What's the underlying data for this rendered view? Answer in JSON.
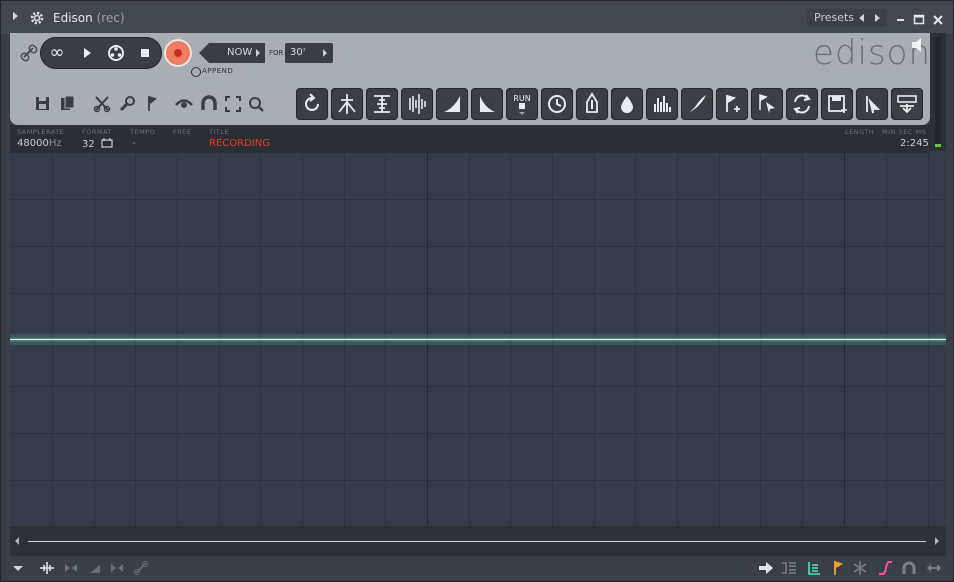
{
  "window": {
    "title": "Edison",
    "subtitle": "(rec)",
    "presets_label": "Presets"
  },
  "transport": {
    "now_label": "NOW",
    "for_label": "FOR",
    "duration": "30'",
    "append_label": "APPEND",
    "record_color": "#f07d63"
  },
  "logo": {
    "text": "edison"
  },
  "toolbar": {
    "left_icons": [
      "save-icon",
      "copy-icon",
      "cut-icon",
      "wrench-icon",
      "marker-icon",
      "view-icon",
      "snap-magnet-icon",
      "select-all-icon",
      "zoom-icon"
    ],
    "tools": [
      "reverse-icon",
      "normalize-icon",
      "trim-icon",
      "declick-icon",
      "fade-in-icon",
      "fade-out-icon",
      "run-script-icon",
      "time-stretch-icon",
      "noise-gate-icon",
      "denoise-icon",
      "spectrum-icon",
      "eq-icon",
      "add-marker-icon",
      "region-icon",
      "loop-icon",
      "save-region-icon",
      "send-to-playlist-icon",
      "send-to-channel-icon"
    ],
    "run_label": "RUN"
  },
  "info": {
    "samplerate_label": "SAMPLERATE",
    "samplerate_value": "48000",
    "samplerate_unit": "Hz",
    "format_label": "FORMAT",
    "format_value": "32",
    "tempo_label": "TEMPO",
    "tempo_value": "-",
    "free_label": "FREE",
    "title_label": "TITLE",
    "title_value": "RECORDING",
    "length_label": "LENGTH",
    "minsec_label": "MIN:SEC:MS",
    "length_value": "2:245"
  },
  "colors": {
    "accent_recording": "#e0412c",
    "waveform": "#dff3e8",
    "waveform_bg": "#353b4b"
  }
}
